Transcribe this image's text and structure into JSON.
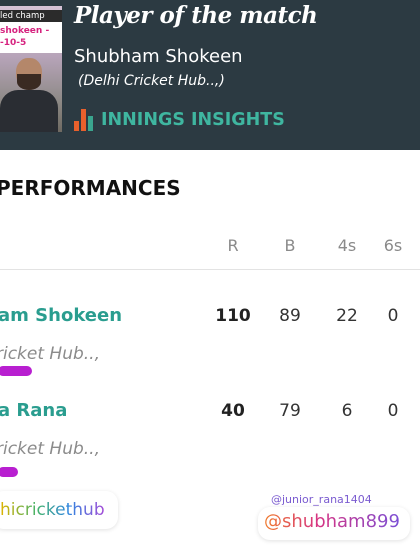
{
  "header": {
    "title": "Player of the match",
    "player_name": "Shubham Shokeen",
    "player_club": "(Delhi Cricket Hub..,)",
    "insights_label": "INNINGS INSIGHTS",
    "photo_banner": {
      "line1": "led champ",
      "line2": "shokeen -",
      "line3": "-10-5"
    }
  },
  "performances": {
    "title": "PERFORMANCES",
    "columns": [
      "R",
      "B",
      "4s",
      "6s"
    ],
    "rows": [
      {
        "name": "am Shokeen",
        "club": "ricket Hub..,",
        "R": "110",
        "B": "89",
        "4s": "22",
        "6s": "0"
      },
      {
        "name": "a Rana",
        "club": "ricket Hub..,",
        "R": "40",
        "B": "79",
        "4s": "6",
        "6s": "0"
      }
    ]
  },
  "watermarks": {
    "left": "hicrickethub",
    "right_small": "@junior_rana1404",
    "right_main": "@shubham899"
  },
  "colors": {
    "header_bg": "#2c3a42",
    "accent_teal": "#2a9d8f",
    "scribble_magenta": "#b81fd0"
  }
}
